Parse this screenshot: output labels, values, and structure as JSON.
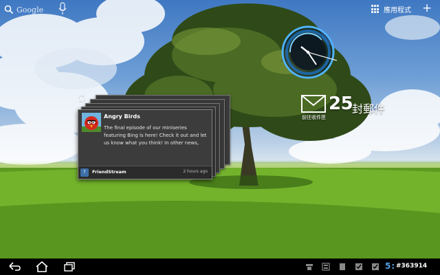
{
  "search": {
    "brand": "Google"
  },
  "top_bar": {
    "apps_label": "應用程式",
    "add_icon": "plus-icon"
  },
  "colors": {
    "clock_accent": "#4fb3ff",
    "nav_accent": "#4fa2e6",
    "card_bg": "#3c3c3c"
  },
  "email_widget": {
    "count": "25",
    "unit": "封郵件",
    "subtitle": "前往收件匣"
  },
  "friendstream": {
    "post": {
      "title": "Angry Birds",
      "body": "The final episode of our miniseries featuring Bing is here! Check it out and let us know what you think! In other news,",
      "source": "FriendStream",
      "time": "2 hours ago"
    }
  },
  "navbar": {
    "buttons": [
      "back-icon",
      "home-icon",
      "recent-apps-icon"
    ],
    "time_partial": "5:",
    "watermark": "#363914"
  }
}
